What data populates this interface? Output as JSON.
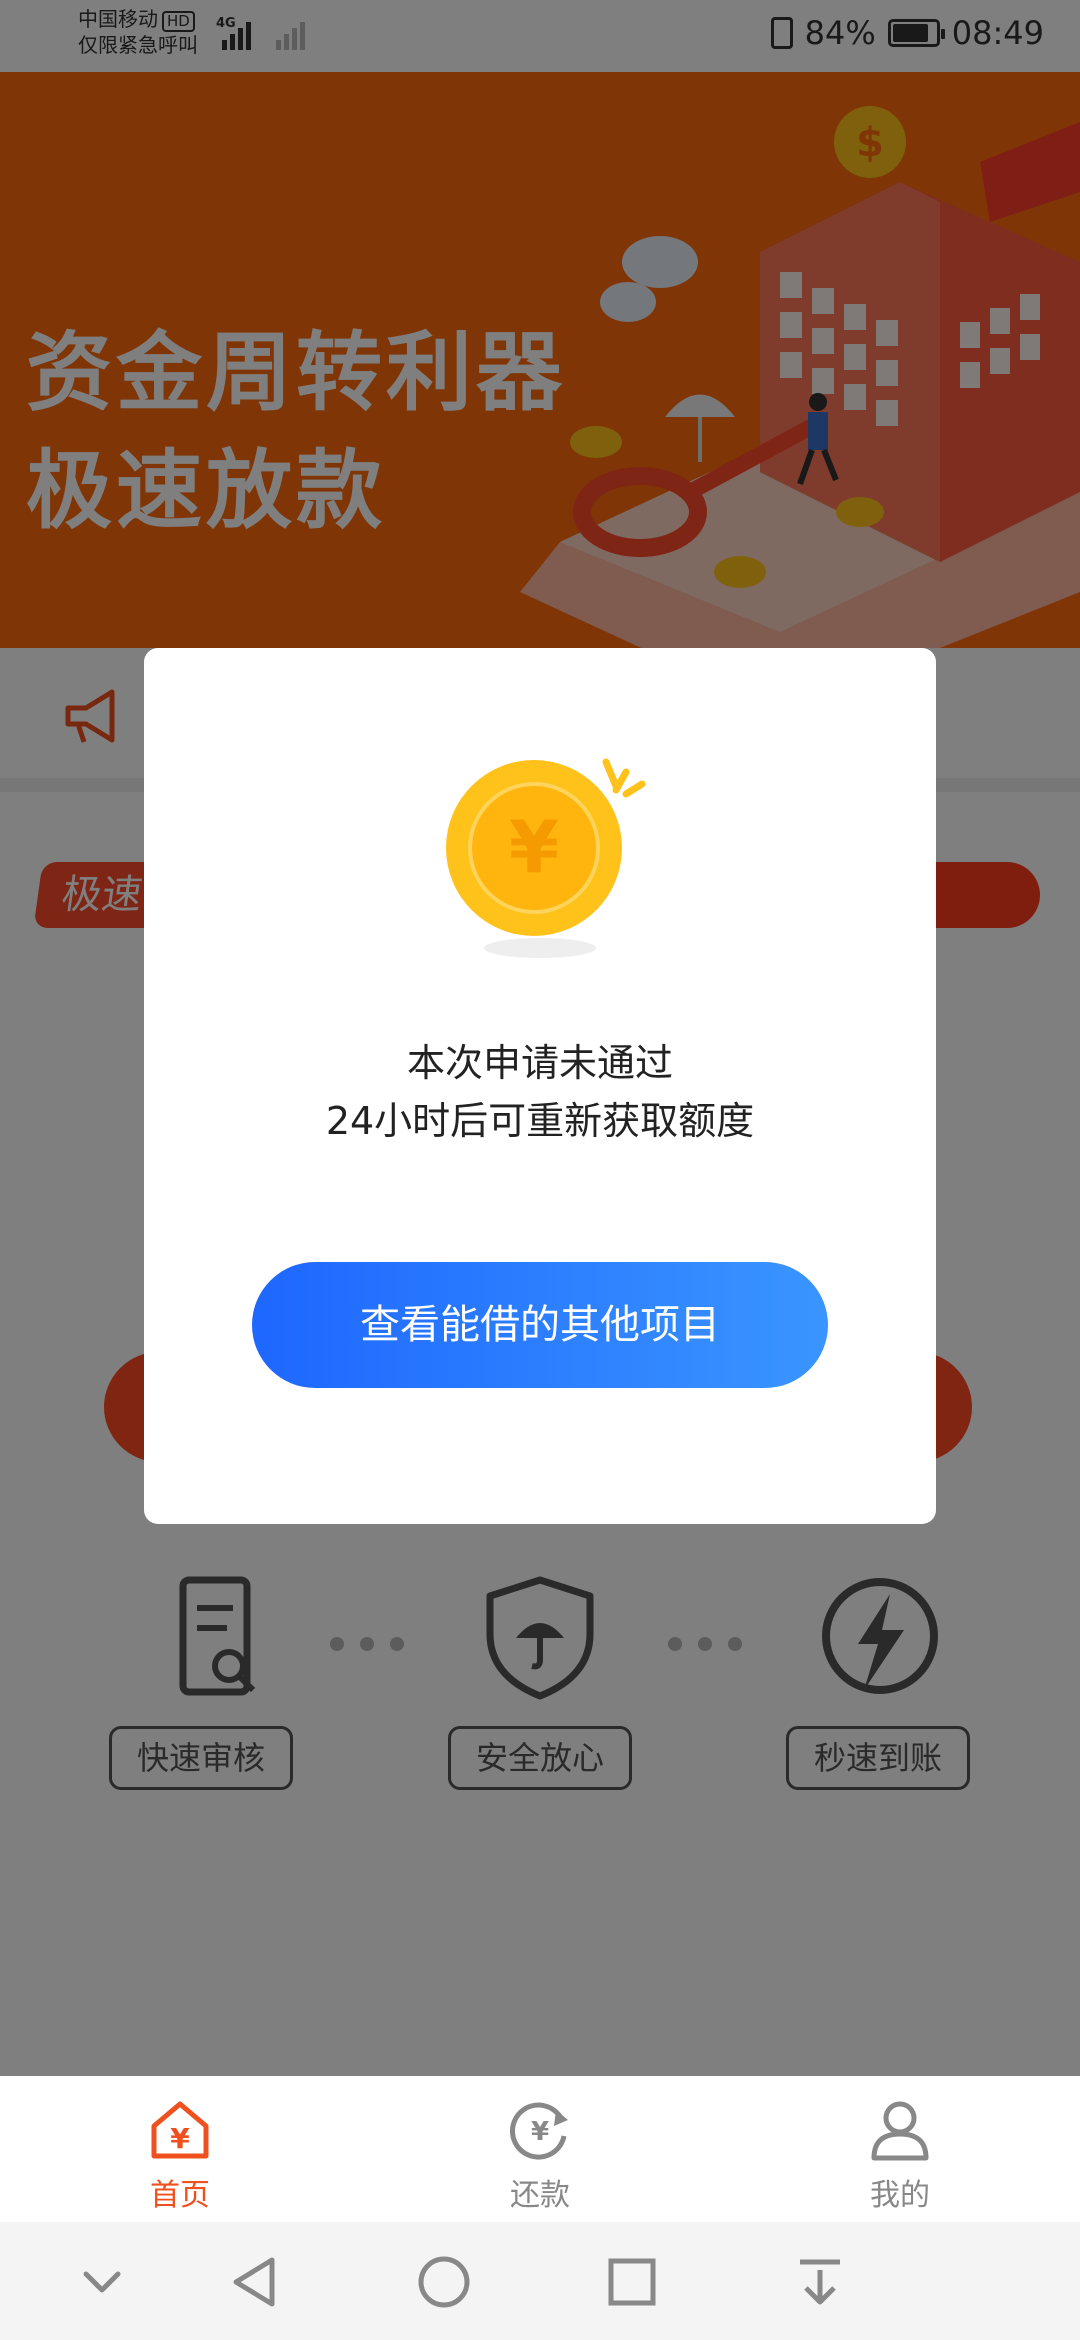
{
  "status_bar": {
    "carrier": "中国移动",
    "hd": "HD",
    "emergency": "仅限紧急呼叫",
    "network": "4G",
    "battery": "84%",
    "battery_level": 0.84,
    "time": "08:49"
  },
  "banner": {
    "line1": "资金周转利器",
    "line2": "极速放款",
    "currency_symbol": "$"
  },
  "main": {
    "tag_label": "极速"
  },
  "features": [
    {
      "label": "快速审核",
      "icon": "document-search-icon"
    },
    {
      "label": "安全放心",
      "icon": "shield-umbrella-icon"
    },
    {
      "label": "秒速到账",
      "icon": "lightning-icon"
    }
  ],
  "tabbar": {
    "tabs": [
      {
        "label": "首页",
        "icon": "home-yen-icon",
        "active": true
      },
      {
        "label": "还款",
        "icon": "repay-yen-icon",
        "active": false
      },
      {
        "label": "我的",
        "icon": "user-icon",
        "active": false
      }
    ]
  },
  "dialog": {
    "coin_symbol": "¥",
    "line1": "本次申请未通过",
    "line2": "24小时后可重新获取额度",
    "button": "查看能借的其他项目"
  },
  "colors": {
    "accent": "#f0501e",
    "banner": "#ff6a0a",
    "button_start": "#1e67ff",
    "button_end": "#3a95ff",
    "coin": "#ffc21a"
  }
}
